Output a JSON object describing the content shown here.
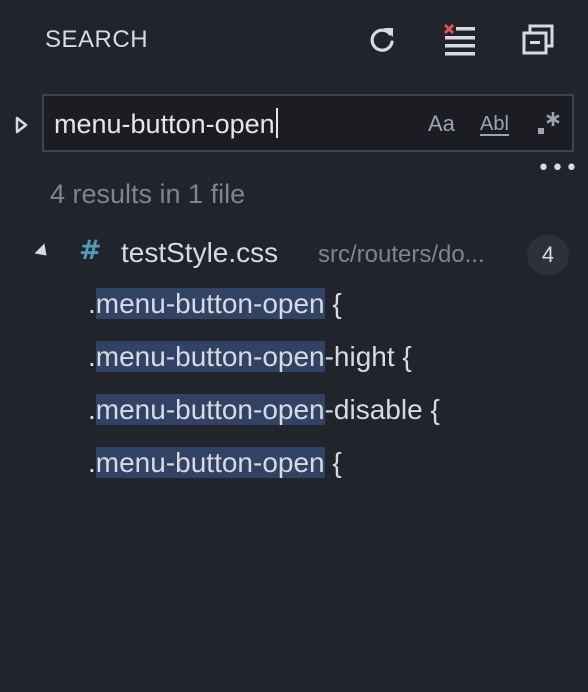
{
  "header": {
    "title": "SEARCH",
    "actions": [
      {
        "name": "refresh",
        "icon": "refresh-icon"
      },
      {
        "name": "clear-results",
        "icon": "clear-all-icon"
      },
      {
        "name": "collapse-all",
        "icon": "collapse-all-icon"
      }
    ]
  },
  "search": {
    "value": "menu-button-open",
    "options": {
      "match_case": "Aa",
      "whole_word": "Abl",
      "regex": ".*"
    },
    "more_label": "•••"
  },
  "summary": "4 results in 1 file",
  "file": {
    "icon_glyph": "#",
    "name": "testStyle.css",
    "path": "src/routers/do...",
    "count": "4"
  },
  "matches": [
    {
      "prefix": ".",
      "match": "menu-button-open",
      "suffix": " {"
    },
    {
      "prefix": ".",
      "match": "menu-button-open",
      "suffix": "-hight {"
    },
    {
      "prefix": ".",
      "match": "menu-button-open",
      "suffix": "-disable {"
    },
    {
      "prefix": ".",
      "match": "menu-button-open",
      "suffix": " {"
    }
  ],
  "colors": {
    "background": "#21252b",
    "match_highlight": "#314365",
    "css_icon": "#519aba",
    "clear_x": "#e05252"
  }
}
